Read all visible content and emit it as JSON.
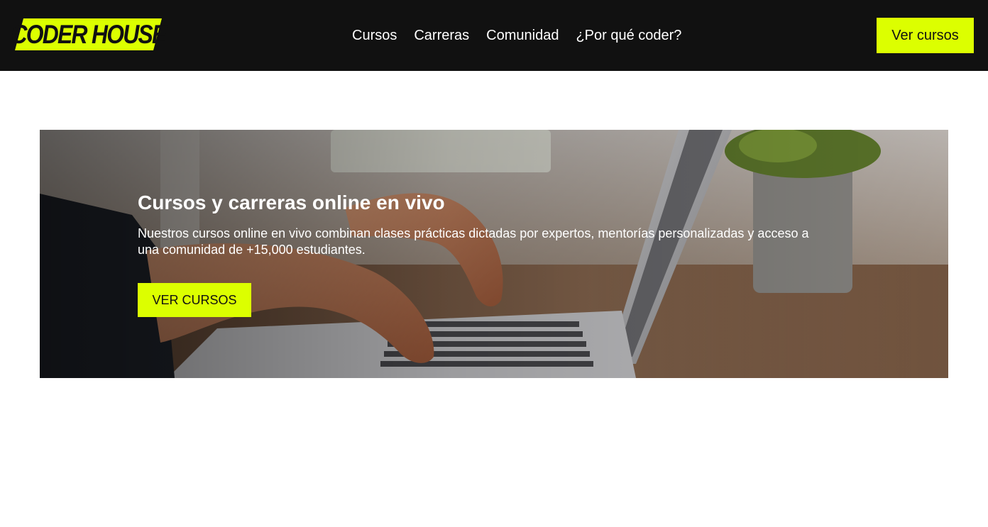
{
  "header": {
    "logo_text": "CODER HOUSE",
    "nav": [
      {
        "label": "Cursos"
      },
      {
        "label": "Carreras"
      },
      {
        "label": "Comunidad"
      },
      {
        "label": "¿Por qué coder?"
      }
    ],
    "cta_label": "Ver cursos"
  },
  "hero": {
    "title": "Cursos y carreras online en vivo",
    "description": "Nuestros cursos online en vivo combinan clases prácticas dictadas por expertos, mentorías personalizadas y acceso a una comunidad de +15,000 estudiantes.",
    "cta_label": "VER CURSOS",
    "image": "hands-typing-on-laptop-photo"
  },
  "colors": {
    "header_bg": "#111111",
    "accent": "#dcff00",
    "page_bg": "#ffffff",
    "text_light": "#ffffff",
    "text_dark": "#111111"
  }
}
